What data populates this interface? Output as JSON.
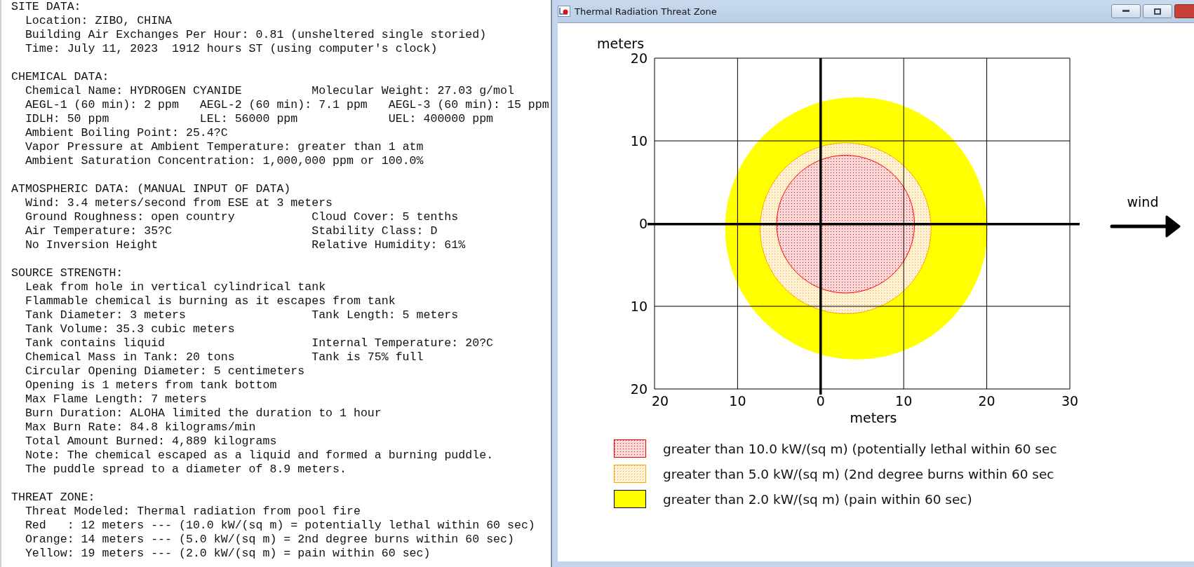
{
  "report": [
    {
      "heading": "SITE DATA:",
      "lines": [
        [
          "Location: ZIBO, CHINA"
        ],
        [
          "Building Air Exchanges Per Hour: 0.81 (unsheltered single storied)"
        ],
        [
          "Time: July 11, 2023  1912 hours ST (using computer's clock)"
        ]
      ]
    },
    {
      "heading": "CHEMICAL DATA:",
      "lines": [
        [
          "Chemical Name: HYDROGEN CYANIDE",
          "Molecular Weight: 27.03 g/mol"
        ],
        [
          "AEGL-1 (60 min): 2 ppm",
          "AEGL-2 (60 min): 7.1 ppm",
          "AEGL-3 (60 min): 15 ppm"
        ],
        [
          "IDLH: 50 ppm",
          "LEL: 56000 ppm",
          "UEL: 400000 ppm"
        ],
        [
          "Ambient Boiling Point: 25.4?C"
        ],
        [
          "Vapor Pressure at Ambient Temperature: greater than 1 atm"
        ],
        [
          "Ambient Saturation Concentration: 1,000,000 ppm or 100.0%"
        ]
      ]
    },
    {
      "heading": "ATMOSPHERIC DATA: (MANUAL INPUT OF DATA)",
      "lines": [
        [
          "Wind: 3.4 meters/second from ESE at 3 meters"
        ],
        [
          "Ground Roughness: open country",
          "Cloud Cover: 5 tenths"
        ],
        [
          "Air Temperature: 35?C",
          "Stability Class: D"
        ],
        [
          "No Inversion Height",
          "Relative Humidity: 61%"
        ]
      ]
    },
    {
      "heading": "SOURCE STRENGTH:",
      "lines": [
        [
          "Leak from hole in vertical cylindrical tank"
        ],
        [
          "Flammable chemical is burning as it escapes from tank"
        ],
        [
          "Tank Diameter: 3 meters",
          "Tank Length: 5 meters"
        ],
        [
          "Tank Volume: 35.3 cubic meters"
        ],
        [
          "Tank contains liquid",
          "Internal Temperature: 20?C"
        ],
        [
          "Chemical Mass in Tank: 20 tons",
          "Tank is 75% full"
        ],
        [
          "Circular Opening Diameter: 5 centimeters"
        ],
        [
          "Opening is 1 meters from tank bottom"
        ],
        [
          "Max Flame Length: 7 meters"
        ],
        [
          "Burn Duration: ALOHA limited the duration to 1 hour"
        ],
        [
          "Max Burn Rate: 84.8 kilograms/min"
        ],
        [
          "Total Amount Burned: 4,889 kilograms"
        ],
        [
          "Note: The chemical escaped as a liquid and formed a burning puddle."
        ],
        [
          "The puddle spread to a diameter of 8.9 meters."
        ]
      ]
    },
    {
      "heading": "THREAT ZONE:",
      "lines": [
        [
          "Threat Modeled: Thermal radiation from pool fire"
        ],
        [
          "Red   : 12 meters --- (10.0 kW/(sq m) = potentially lethal within 60 sec)"
        ],
        [
          "Orange: 14 meters --- (5.0 kW/(sq m) = 2nd degree burns within 60 sec)"
        ],
        [
          "Yellow: 19 meters --- (2.0 kW/(sq m) = pain within 60 sec)"
        ]
      ]
    }
  ],
  "window": {
    "title": "Thermal Radiation Threat Zone"
  },
  "plot": {
    "y_label": "meters",
    "x_label": "meters",
    "wind_label": "wind",
    "y_ticks": [
      "20",
      "10",
      "0",
      "10",
      "20"
    ],
    "x_ticks": [
      "20",
      "10",
      "0",
      "10",
      "20",
      "30"
    ]
  },
  "legend": [
    {
      "kind": "dotted",
      "color": "#ff0000",
      "label": "greater than 10.0 kW/(sq m) (potentially lethal within 60 sec"
    },
    {
      "kind": "dotted",
      "color": "#ffa500",
      "label": "greater than 5.0 kW/(sq m) (2nd degree burns within 60 sec"
    },
    {
      "kind": "solid",
      "color": "#ffff00",
      "label": "greater than 2.0 kW/(sq m) (pain within 60 sec)"
    }
  ]
}
